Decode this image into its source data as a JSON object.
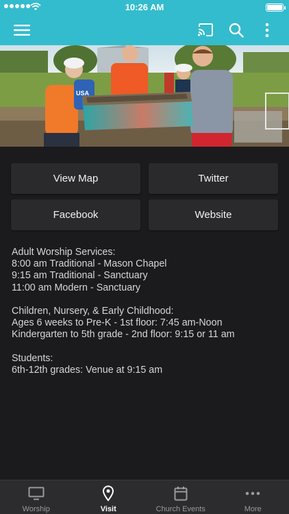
{
  "status": {
    "time": "10:26 AM"
  },
  "actions": [
    {
      "label": "View Map"
    },
    {
      "label": "Twitter"
    },
    {
      "label": "Facebook"
    },
    {
      "label": "Website"
    }
  ],
  "info_lines": [
    "Adult Worship Services:",
    "8:00 am Traditional - Mason Chapel",
    "9:15 am Traditional - Sanctuary",
    "11:00 am Modern - Sanctuary",
    "",
    "Children, Nursery, & Early Childhood:",
    "Ages 6 weeks to Pre-K - 1st floor: 7:45 am-Noon",
    "Kindergarten to 5th grade - 2nd floor: 9:15 or 11 am",
    "",
    "Students:",
    "6th-12th grades: Venue at 9:15 am"
  ],
  "tabs": [
    {
      "label": "Worship",
      "icon": "monitor-icon"
    },
    {
      "label": "Visit",
      "icon": "location-pin-icon"
    },
    {
      "label": "Church Events",
      "icon": "calendar-icon"
    },
    {
      "label": "More",
      "icon": "more-dots-icon"
    }
  ],
  "hero": {
    "shirt_text": "USA"
  },
  "colors": {
    "accent": "#33bccd",
    "background": "#1b1b1d",
    "button": "#2a2a2c",
    "tabbar": "#2c2c2e"
  }
}
